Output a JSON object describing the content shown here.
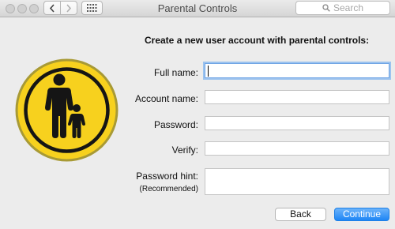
{
  "window": {
    "title": "Parental Controls",
    "search_placeholder": "Search"
  },
  "form": {
    "heading": "Create a new user account with parental controls:",
    "full_name_label": "Full name:",
    "account_name_label": "Account name:",
    "password_label": "Password:",
    "verify_label": "Verify:",
    "hint_label": "Password hint:",
    "hint_sublabel": "(Recommended)",
    "full_name_value": "",
    "account_name_value": "",
    "password_value": "",
    "verify_value": "",
    "hint_value": ""
  },
  "buttons": {
    "back": "Back",
    "continue": "Continue"
  },
  "icons": {
    "app": "parental-controls-icon",
    "back": "chevron-left-icon",
    "forward": "chevron-right-icon",
    "grid": "grid-icon",
    "search": "search-icon"
  },
  "colors": {
    "accent": "#1e85f5",
    "icon_yellow": "#f7d11e"
  }
}
